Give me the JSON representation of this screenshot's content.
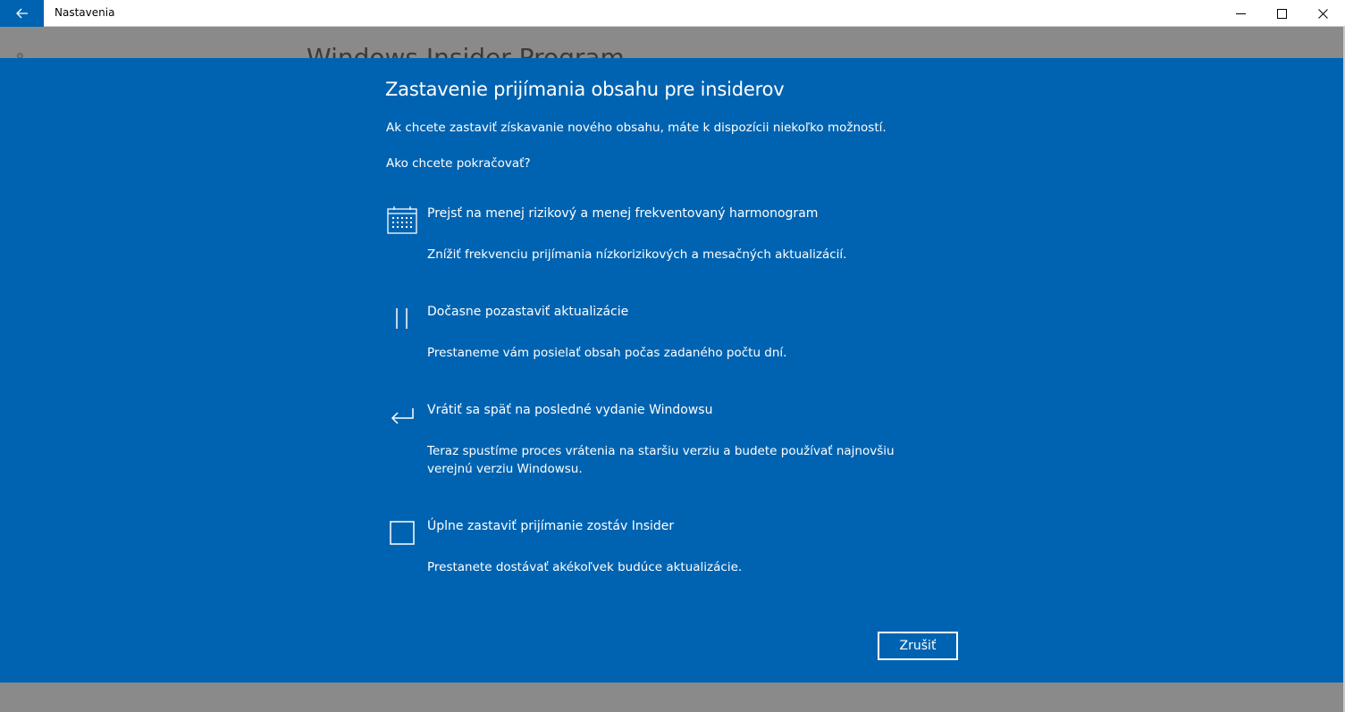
{
  "window": {
    "title": "Nastavenia"
  },
  "background": {
    "header": "Windows Insider Program"
  },
  "dialog": {
    "title": "Zastavenie prijímania obsahu pre insiderov",
    "intro": "Ak chcete zastaviť získavanie nového obsahu, máte k dispozícii niekoľko možností.",
    "question": "Ako chcete pokračovať?",
    "options": [
      {
        "icon": "calendar-icon",
        "title": "Prejsť na menej rizikový a menej frekventovaný harmonogram",
        "description": "Znížiť frekvenciu prijímania nízkorizikových a mesačných aktualizácií."
      },
      {
        "icon": "pause-icon",
        "title": "Dočasne pozastaviť aktualizácie",
        "description": "Prestaneme vám posielať obsah počas zadaného počtu dní."
      },
      {
        "icon": "return-arrow-icon",
        "title": "Vrátiť sa späť na posledné vydanie Windowsu",
        "description": "Teraz spustíme proces vrátenia na staršiu verziu a budete používať najnovšiu verejnú verziu Windowsu."
      },
      {
        "icon": "stop-square-icon",
        "title": "Úplne zastaviť prijímanie zostáv Insider",
        "description": "Prestanete dostávať akékoľvek budúce aktualizácie."
      }
    ],
    "cancel_label": "Zrušiť"
  },
  "colors": {
    "accent": "#0063b1",
    "overlay": "#8a8a8a",
    "text": "#ffffff"
  }
}
